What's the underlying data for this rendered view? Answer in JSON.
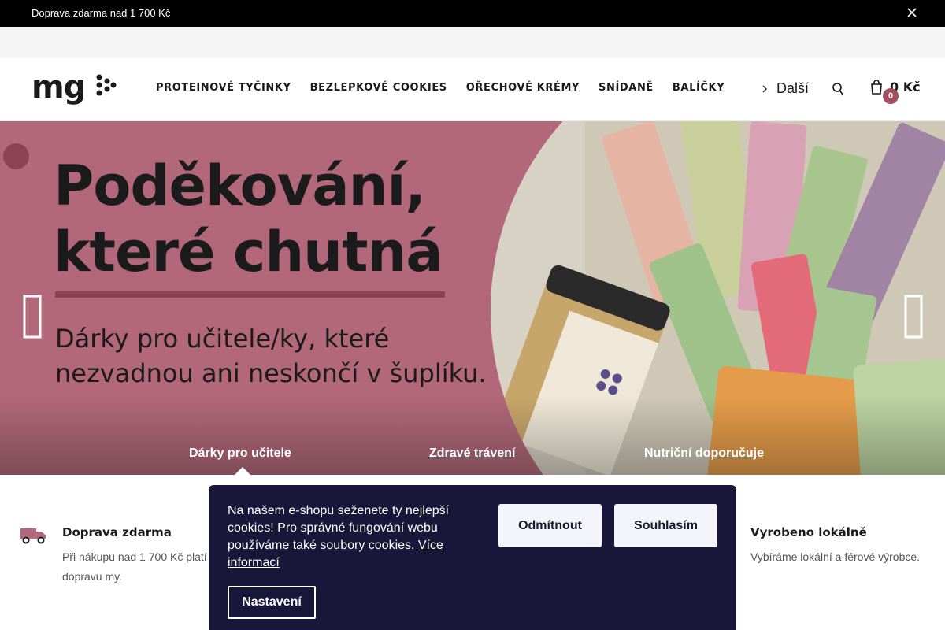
{
  "topbar": {
    "message": "Doprava zdarma nad 1 700 Kč"
  },
  "header": {
    "nav": [
      {
        "label": "PROTEINOVÉ TYČINKY"
      },
      {
        "label": "BEZLEPKOVÉ COOKIES"
      },
      {
        "label": "OŘECHOVÉ KRÉMY"
      },
      {
        "label": "SNÍDANĚ"
      },
      {
        "label": "BALÍČKY"
      }
    ],
    "more_label": "Další",
    "cart_total": "0 Kč",
    "cart_count": "0"
  },
  "hero": {
    "headline_line1": "Poděkování,",
    "headline_line2": "které chutná",
    "subline1": "Dárky pro učitele/ky, které",
    "subline2": "nezvadnou ani neskončí v šuplíku.",
    "tabs": [
      {
        "label": "Dárky pro učitele"
      },
      {
        "label": "Zdravé trávení"
      },
      {
        "label": "Nutriční doporučuje"
      }
    ],
    "colors": {
      "background": "#b2687a",
      "accent": "#8e4256"
    }
  },
  "benefits": [
    {
      "title": "Doprava zdarma",
      "desc_line1": "Při nákupu nad 1 700 Kč platí",
      "desc_line2": "dopravu my."
    },
    {
      "title": "Vyrobeno lokálně",
      "desc_line1": "Vybíráme lokální a férové výrobce."
    }
  ],
  "cookie": {
    "text": "Na našem e-shopu seženete ty nejlepší cookies! Pro správné fungování webu používáme také soubory cookies.",
    "more_link": "Více informací",
    "reject_label": "Odmítnout",
    "accept_label": "Souhlasím",
    "settings_label": "Nastavení"
  },
  "icons": [
    "close-icon",
    "logo",
    "chevron-down-icon",
    "search-icon",
    "cart-icon",
    "arrow-left-icon",
    "arrow-right-icon",
    "truck-icon"
  ]
}
